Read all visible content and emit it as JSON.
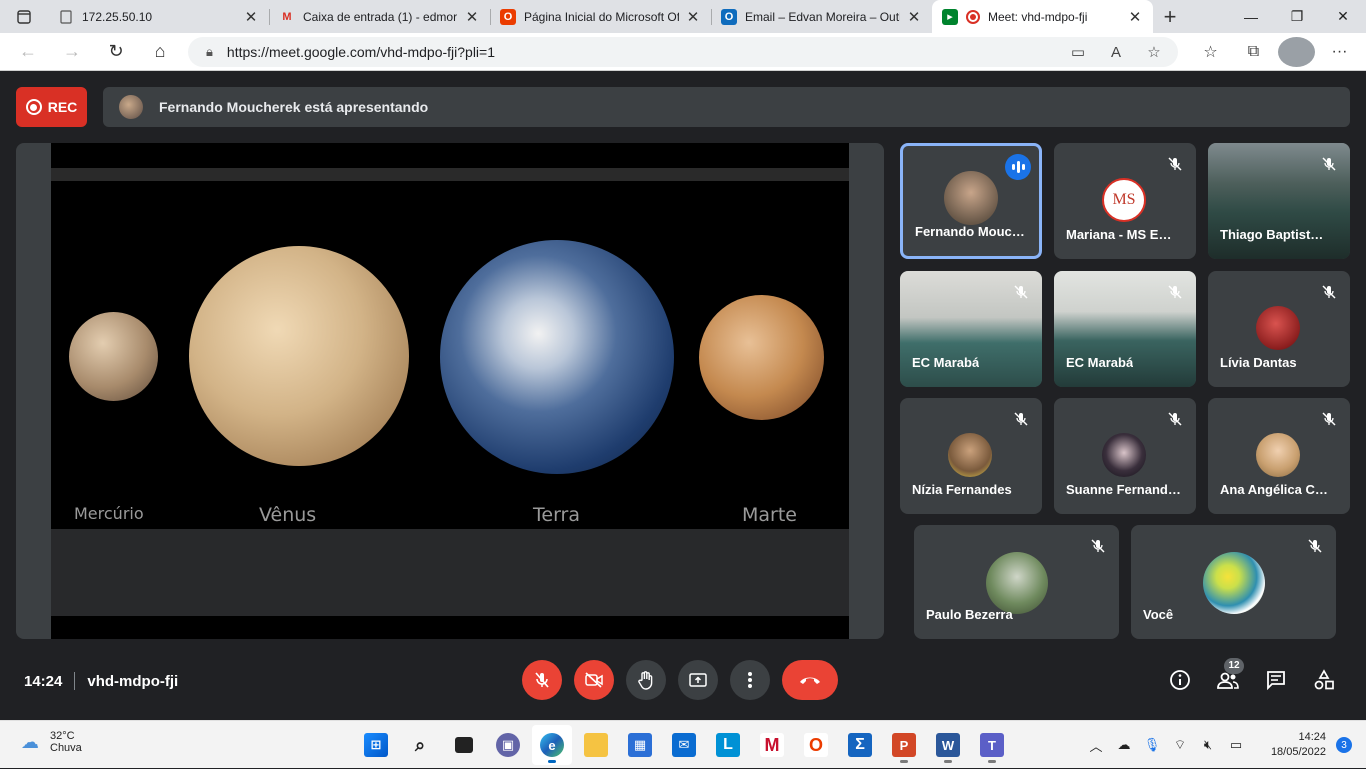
{
  "browser": {
    "tabs": [
      {
        "title": "172.25.50.10",
        "icon": "page-icon",
        "active": false
      },
      {
        "title": "Caixa de entrada (1) - edmor",
        "icon": "gmail-icon",
        "active": false
      },
      {
        "title": "Página Inicial do Microsoft Of",
        "icon": "office-icon",
        "active": false
      },
      {
        "title": "Email – Edvan Moreira – Outl",
        "icon": "outlook-icon",
        "active": false
      },
      {
        "title": "Meet: vhd-mdpo-fji",
        "icon": "meet-icon",
        "active": true
      }
    ],
    "url": "https://meet.google.com/vhd-mdpo-fji?pli=1"
  },
  "meet": {
    "rec_label": "REC",
    "presenting_text": "Fernando Moucherek está apresentando",
    "slide_labels": [
      "Mercúrio",
      "Vênus",
      "Terra",
      "Marte"
    ],
    "participants": [
      {
        "name": "Fernando Mouc…",
        "speaking": true
      },
      {
        "name": "Mariana - MS E…",
        "speaking": false,
        "logo_text": "MS"
      },
      {
        "name": "Thiago Baptist…",
        "speaking": false
      },
      {
        "name": "EC Marabá",
        "speaking": false
      },
      {
        "name": "EC Marabá",
        "speaking": false
      },
      {
        "name": "Lívia Dantas",
        "speaking": false
      },
      {
        "name": "Nízia Fernandes",
        "speaking": false
      },
      {
        "name": "Suanne Fernand…",
        "speaking": false
      },
      {
        "name": "Ana Angélica C…",
        "speaking": false
      },
      {
        "name": "Paulo Bezerra",
        "speaking": false
      },
      {
        "name": "Você",
        "speaking": false
      }
    ],
    "time": "14:24",
    "meeting_code": "vhd-mdpo-fji",
    "people_count": "12",
    "colors": {
      "accent": "#1a73e8",
      "danger": "#ea4335",
      "background": "#202124",
      "tile": "#3c4043"
    }
  },
  "taskbar": {
    "temperature": "32°C",
    "weather": "Chuva",
    "time": "14:24",
    "date": "18/05/2022",
    "notifications": "3"
  }
}
